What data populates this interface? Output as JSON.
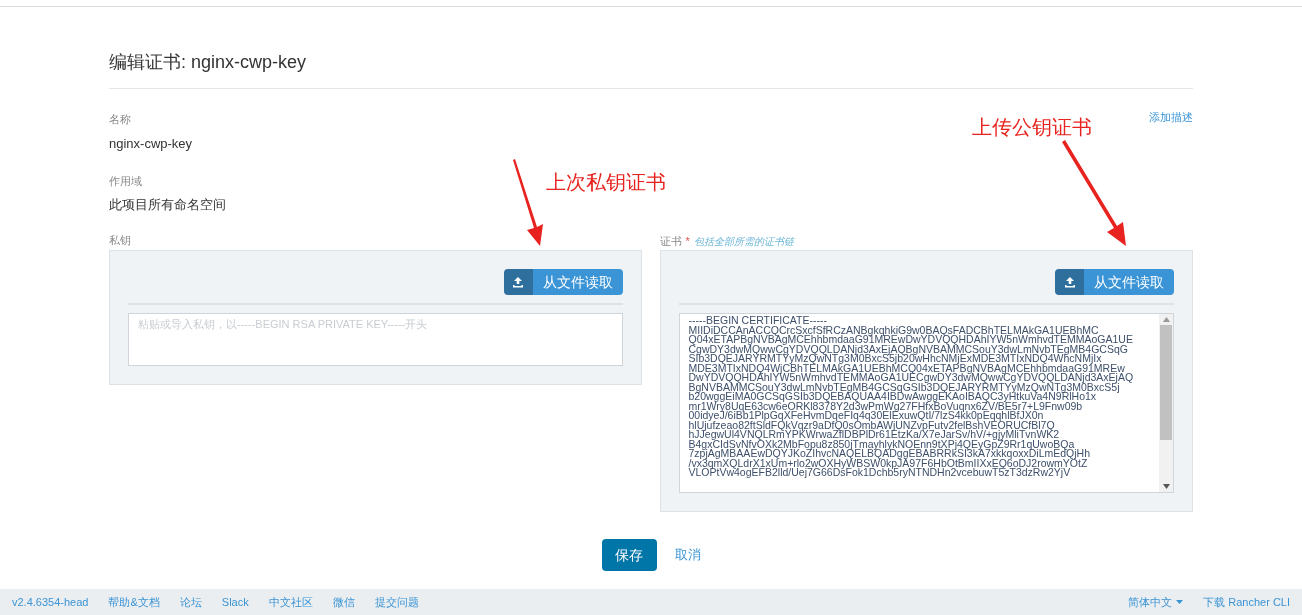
{
  "page_title": "编辑证书: nginx-cwp-key",
  "add_description_link": "添加描述",
  "name_field": {
    "label": "名称",
    "value": "nginx-cwp-key"
  },
  "scope_field": {
    "label": "作用域",
    "value": "此项目所有命名空间"
  },
  "private_key": {
    "label": "私钥",
    "read_file_button": "从文件读取",
    "placeholder": "粘贴或导入私钥，以-----BEGIN RSA PRIVATE KEY-----开头"
  },
  "certificate": {
    "label": "证书",
    "required_mark": "*",
    "hint": "包括全部所需的证书链",
    "read_file_button": "从文件读取",
    "lines": [
      "-----BEGIN CERTIFICATE-----",
      "MIIDiDCCAnACCQCrcSxcfSfRCzANBgkqhkiG9w0BAQsFADCBhTELMAkGA1UEBhMC",
      "Q04xETAPBgNVBAgMCEhhbmdaaG91MREwDwYDVQQHDAhIYW5nWmhvdTEMMAoGA1UE",
      "CgwDY3dwMQwwCgYDVQQLDANjd3AxEjAQBgNVBAMMCSouY3dwLmNvbTEgMB4GCSqG",
      "SIb3DQEJARYRMTYyMzQwNTg3M0BxcS5jb20wHhcNMjExMDE3MTIxNDQ4WhcNMjIx",
      "MDE3MTIxNDQ4WjCBhTELMAkGA1UEBhMCQ04xETAPBgNVBAgMCEhhbmdaaG91MREw",
      "DwYDVQQHDAhIYW5nWmhvdTEMMAoGA1UECgwDY3dwMQwwCgYDVQQLDANjd3AxEjAQ",
      "BgNVBAMMCSouY3dwLmNvbTEgMB4GCSqGSIb3DQEJARYRMTYyMzQwNTg3M0BxcS5j",
      "b20wggEiMA0GCSqGSIb3DQEBAQUAA4IBDwAwggEKAoIBAQC3yHtkuVa4N9RlHo1x",
      "mr1Wry8UqE63cw6eORKl8378Y2d3wPmWg27FHfxBoVuqnx6ZV/BE5r7+L9Fnw09b",
      "00idyeJ/6iBb1PlpGqXFeHvmDqeFIq4q30ElExuwQtI/7lzS4kk0pEqqhlBfJX0n",
      "hlUjufzeao82ftSldFQkVqzr9aDfQ0sOmbAWjUNZvpFutv2felBshVEORUCfBl7Q",
      "hJJegwUl4VNQLRmYPKWrwaZflDBPlDr61EtzKa/X7eJarSv/hV/+gjyMliTvnWK2",
      "B4gxCIdSvNfvOXk2MbFopu8z850jTmayhlykNOEnn9tXPj4QEyGpZ9Rr1qUwoBQa",
      "7zpjAgMBAAEwDQYJKoZIhvcNAQELBQADggEBABRRkSI3kA7xkkqoxxDiLmEdQjHh",
      "/vx3qmXQLdrX1xUm+rlo2wOXHyWBSW0kpJA97F6HbOtBmIIXxEQ6oDJ2rowmYOtZ",
      "VLOPtVw4ogEFB2lld/Uej7G66DsFok1Dchb5ryNTNDHn2vcebuwT5zT3dzRw2YjV"
    ]
  },
  "annotations": [
    {
      "text": "上次私钥证书"
    },
    {
      "text": "上传公钥证书"
    }
  ],
  "buttons": {
    "save": "保存",
    "cancel": "取消"
  },
  "footer": {
    "links": [
      "v2.4.6354-head",
      "帮助&文档",
      "论坛",
      "Slack",
      "中文社区",
      "微信",
      "提交问题"
    ],
    "language": "简体中文",
    "download": "下载 Rancher CLI"
  }
}
